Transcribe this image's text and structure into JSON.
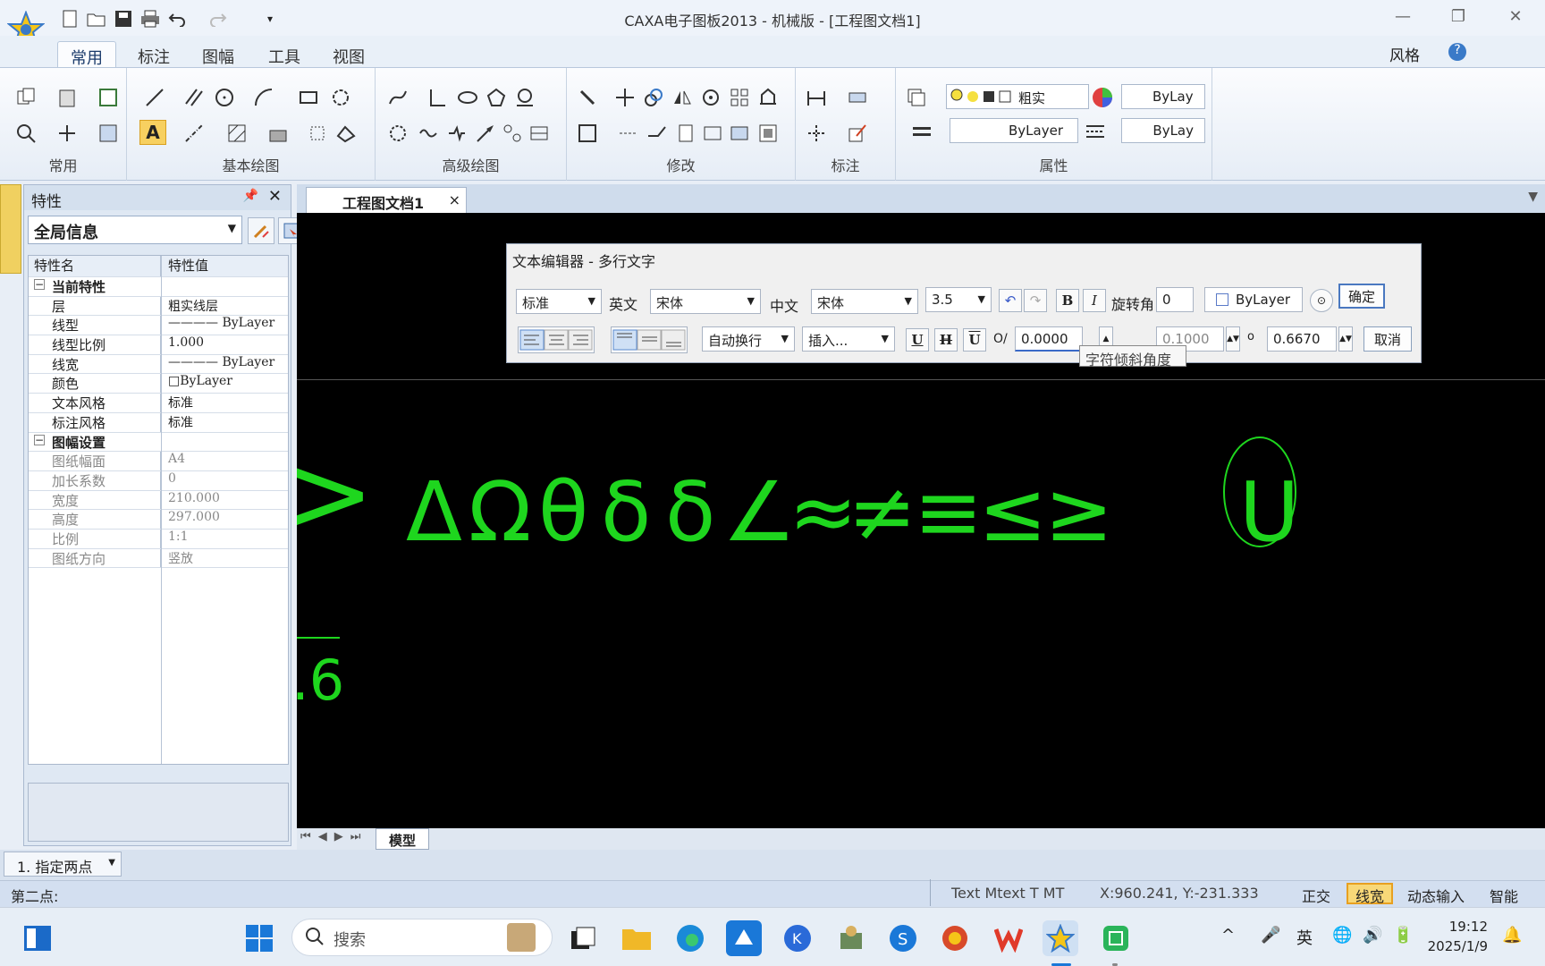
{
  "window": {
    "title": "CAXA电子图板2013 - 机械版 - [工程图文档1]",
    "min": "—",
    "max": "❐",
    "close": "✕"
  },
  "ribbon_tabs": [
    "常用",
    "标注",
    "图幅",
    "工具",
    "视图"
  ],
  "ribbon_right": {
    "style_label": "风格"
  },
  "ribbon_groups": [
    "常用",
    "基本绘图",
    "高级绘图",
    "修改",
    "标注",
    "属性"
  ],
  "ribbon_props": {
    "layer": "粗实",
    "color": "ByLay",
    "linetype": "ByLayer",
    "lineweight": "ByLay"
  },
  "properties_panel": {
    "title": "特性",
    "scope": "全局信息",
    "col_name": "特性名",
    "col_value": "特性值",
    "section_current": "当前特性",
    "current": [
      {
        "k": "层",
        "v": "粗实线层"
      },
      {
        "k": "线型",
        "v": "———— ByLayer"
      },
      {
        "k": "线型比例",
        "v": "1.000"
      },
      {
        "k": "线宽",
        "v": "———— ByLayer"
      },
      {
        "k": "颜色",
        "v": "□ByLayer"
      },
      {
        "k": "文本风格",
        "v": "标准"
      },
      {
        "k": "标注风格",
        "v": "标准"
      }
    ],
    "section_sheet": "图幅设置",
    "sheet": [
      {
        "k": "图纸幅面",
        "v": "A4"
      },
      {
        "k": "加长系数",
        "v": "0"
      },
      {
        "k": "宽度",
        "v": "210.000"
      },
      {
        "k": "高度",
        "v": "297.000"
      },
      {
        "k": "比例",
        "v": "1:1"
      },
      {
        "k": "图纸方向",
        "v": "竖放"
      }
    ]
  },
  "doc_tab": {
    "label": "工程图文档1",
    "close": "×"
  },
  "canvas": {
    "glyphs": [
      ">",
      "Δ",
      "Ω",
      "θ",
      "δ",
      "δ",
      "∠",
      "≈",
      "≠",
      "≡",
      "≤",
      "≥",
      "U"
    ],
    "fragment": ".6"
  },
  "text_editor": {
    "title": "文本编辑器 - 多行文字",
    "style": "标准",
    "en_label": "英文",
    "en_font": "宋体",
    "cn_label": "中文",
    "cn_font": "宋体",
    "height": "3.5",
    "bold": "B",
    "italic": "I",
    "rotation_label": "旋转角",
    "rotation": "0",
    "color": "ByLayer",
    "ok": "确定",
    "wrap": "自动换行",
    "insert": "插入...",
    "underline": "U",
    "strike": "H",
    "overline": "U",
    "oblique_label": "O/",
    "oblique": "0.0000",
    "spacing": "0.1000",
    "width_factor": "0.6670",
    "cancel": "取消",
    "tooltip": "字符倾斜角度"
  },
  "model_tab": "模型",
  "command": {
    "item": "1. 指定两点"
  },
  "status_bar": {
    "prompt": "第二点:",
    "command": "Text Mtext T MT",
    "coords": "X:960.241, Y:-231.333",
    "modes": [
      "正交",
      "线宽",
      "动态输入",
      "智能"
    ]
  },
  "taskbar": {
    "search_placeholder": "搜索",
    "ime": "英",
    "time": "19:12",
    "date": "2025/1/9"
  }
}
